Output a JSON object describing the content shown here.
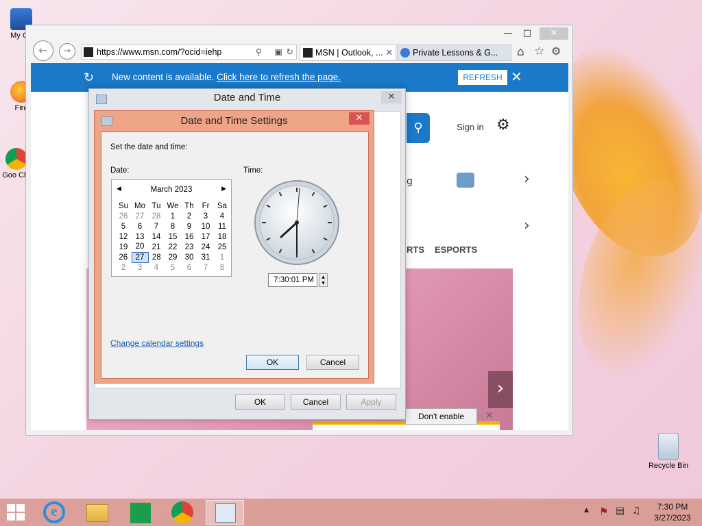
{
  "desktop": {
    "icons": [
      {
        "label": "My Co"
      },
      {
        "label": "Fire"
      },
      {
        "label": "Goo Chr"
      },
      {
        "label": "Recycle Bin"
      }
    ]
  },
  "browser": {
    "address": "https://www.msn.com/?ocid=iehp",
    "tabs": [
      {
        "title": "MSN | Outlook, ..."
      },
      {
        "title": "Private Lessons & G..."
      }
    ],
    "notification": {
      "text": "New content is available.",
      "link": "Click here to refresh the page.",
      "button": "REFRESH"
    },
    "page": {
      "sign_in": "Sign in",
      "nav_items": [
        "RTS",
        "ESPORTS"
      ],
      "partial_text": "g"
    },
    "popup": {
      "button": "Don't enable"
    }
  },
  "date_time_dialog": {
    "title": "Date and Time",
    "buttons": {
      "ok": "OK",
      "cancel": "Cancel",
      "apply": "Apply"
    }
  },
  "settings_dialog": {
    "title": "Date and Time Settings",
    "instruction": "Set the date and time:",
    "date_label": "Date:",
    "time_label": "Time:",
    "calendar": {
      "month": "March 2023",
      "weekdays": [
        "Su",
        "Mo",
        "Tu",
        "We",
        "Th",
        "Fr",
        "Sa"
      ],
      "weeks": [
        [
          "26",
          "27",
          "28",
          "1",
          "2",
          "3",
          "4"
        ],
        [
          "5",
          "6",
          "7",
          "8",
          "9",
          "10",
          "11"
        ],
        [
          "12",
          "13",
          "14",
          "15",
          "16",
          "17",
          "18"
        ],
        [
          "19",
          "20",
          "21",
          "22",
          "23",
          "24",
          "25"
        ],
        [
          "26",
          "27",
          "28",
          "29",
          "30",
          "31",
          "1"
        ],
        [
          "2",
          "3",
          "4",
          "5",
          "6",
          "7",
          "8"
        ]
      ],
      "selected": "27"
    },
    "time_value": "7:30:01 PM",
    "change_link": "Change calendar settings",
    "buttons": {
      "ok": "OK",
      "cancel": "Cancel"
    }
  },
  "taskbar": {
    "clock_time": "7:30 PM",
    "clock_date": "3/27/2023"
  },
  "colors": {
    "accent": "#1a79c8",
    "dialog_frame": "#eea486",
    "taskbar": "#d6968c"
  }
}
